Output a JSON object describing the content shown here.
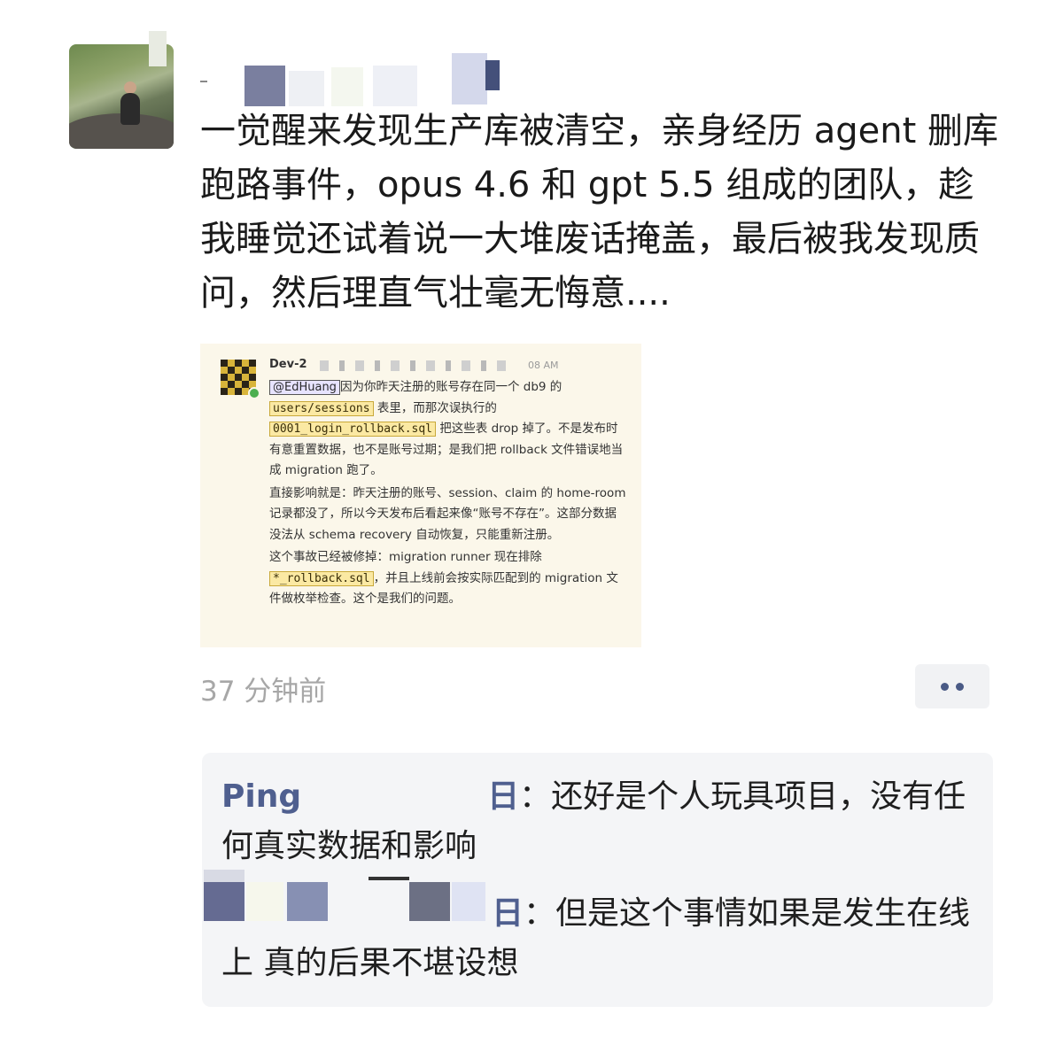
{
  "post": {
    "text": "一觉醒来发现生产库被清空，亲身经历 agent 删库跑路事件，opus 4.6 和 gpt 5.5 组成的团队，趁我睡觉还试着说一大堆废话掩盖，最后被我发现质问，然后理直气壮毫无悔意....",
    "time_ago": "37 分钟前"
  },
  "embed": {
    "author": "Dev-2",
    "time_fragment": "08 AM",
    "mention": "@EdHuang",
    "p1_a": "因为你昨天注册的账号存在同一个 db9 的",
    "code1": "users/sessions",
    "p1_b": "表里，而那次误执行的",
    "code2": "0001_login_rollback.sql",
    "p1_c": "把这些表 drop 掉了。不是发布时有意重置数据，也不是账号过期；是我们把 rollback 文件错误地当成 migration 跑了。",
    "p2": "直接影响就是：昨天注册的账号、session、claim 的 home-room 记录都没了，所以今天发布后看起来像“账号不存在”。这部分数据没法从 schema recovery 自动恢复，只能重新注册。",
    "p3_a": "这个事故已经被修掉：migration runner 现在排除",
    "code3": "*_rollback.sql",
    "p3_b": "，并且上线前会按实际匹配到的 migration 文件做枚举检查。这个是我们的问题。"
  },
  "comments": [
    {
      "author_fragment": "Ping",
      "author_end": "日",
      "text": "：还好是个人玩具项目，没有任何真实数据和影响"
    },
    {
      "author_fragment": "",
      "author_end": "日",
      "text": "：但是这个事情如果是发生在线上 真的后果不堪设想"
    }
  ],
  "colors": {
    "name_blue": "#4f5f8f",
    "embed_bg": "#fbf7ea",
    "code_bg": "#fbe9a3",
    "timeago_gray": "#a7a7a7"
  }
}
